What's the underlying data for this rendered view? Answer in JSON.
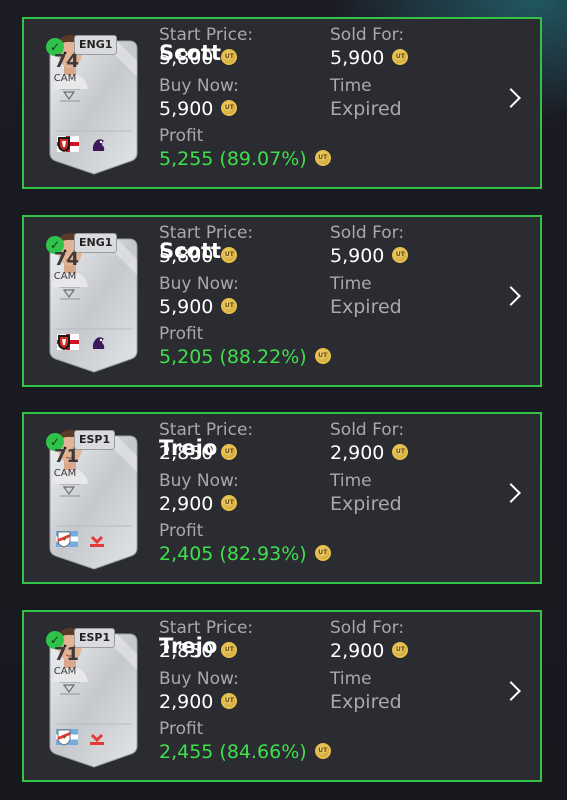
{
  "labels": {
    "start_price": "Start Price:",
    "buy_now": "Buy Now:",
    "profit": "Profit",
    "sold_for": "Sold For:",
    "time": "Time",
    "coin_glyph": "UT"
  },
  "rows": [
    {
      "name": "Scott",
      "start_price": "5,800",
      "buy_now": "5,900",
      "sold_for": "5,900",
      "time": "Expired",
      "profit": "5,255 (89.07%)",
      "rating": "74",
      "position": "CAM",
      "league": "ENG1",
      "nation_flag": "england-flag",
      "club_icon": "bournemouth-badge"
    },
    {
      "name": "Scott",
      "start_price": "5,800",
      "buy_now": "5,900",
      "sold_for": "5,900",
      "time": "Expired",
      "profit": "5,205 (88.22%)",
      "rating": "74",
      "position": "CAM",
      "league": "ENG1",
      "nation_flag": "england-flag",
      "club_icon": "bournemouth-badge"
    },
    {
      "name": "Trejo",
      "start_price": "2,850",
      "buy_now": "2,900",
      "sold_for": "2,900",
      "time": "Expired",
      "profit": "2,405 (82.93%)",
      "rating": "71",
      "position": "CAM",
      "league": "ESP1",
      "nation_flag": "argentina-flag",
      "club_icon": "rayo-vallecano-badge"
    },
    {
      "name": "Trejo",
      "start_price": "2,850",
      "buy_now": "2,900",
      "sold_for": "2,900",
      "time": "Expired",
      "profit": "2,455 (84.66%)",
      "rating": "71",
      "position": "CAM",
      "league": "ESP1",
      "nation_flag": "argentina-flag",
      "club_icon": "rayo-vallecano-badge"
    }
  ],
  "colors": {
    "border": "#33c245",
    "profit": "#3ee04c",
    "row_bg": "#2b2b32",
    "label": "#a8a8ad"
  }
}
